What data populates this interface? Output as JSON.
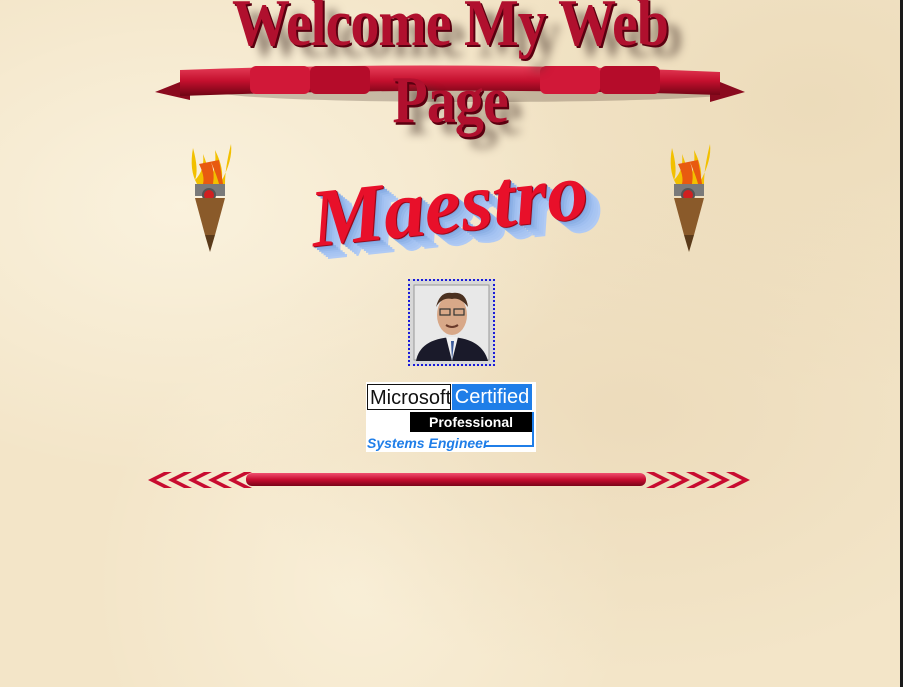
{
  "page": {
    "title": "Welcome My  Web Page"
  },
  "logo": {
    "text": "Maestro"
  },
  "photo": {
    "description_label": ""
  },
  "badge": {
    "microsoft": "Microsoft",
    "certified": "Certified",
    "professional": "Professional",
    "systems_engineer": "Systems Engineer"
  },
  "colors": {
    "banner_red": "#b0102e",
    "logo_red": "#e8102a",
    "badge_blue": "#1f7ee8",
    "background": "#f3e5c8"
  },
  "icons": [
    "torch-icon-left",
    "torch-icon-right",
    "ribbon-banner",
    "arrow-divider"
  ]
}
